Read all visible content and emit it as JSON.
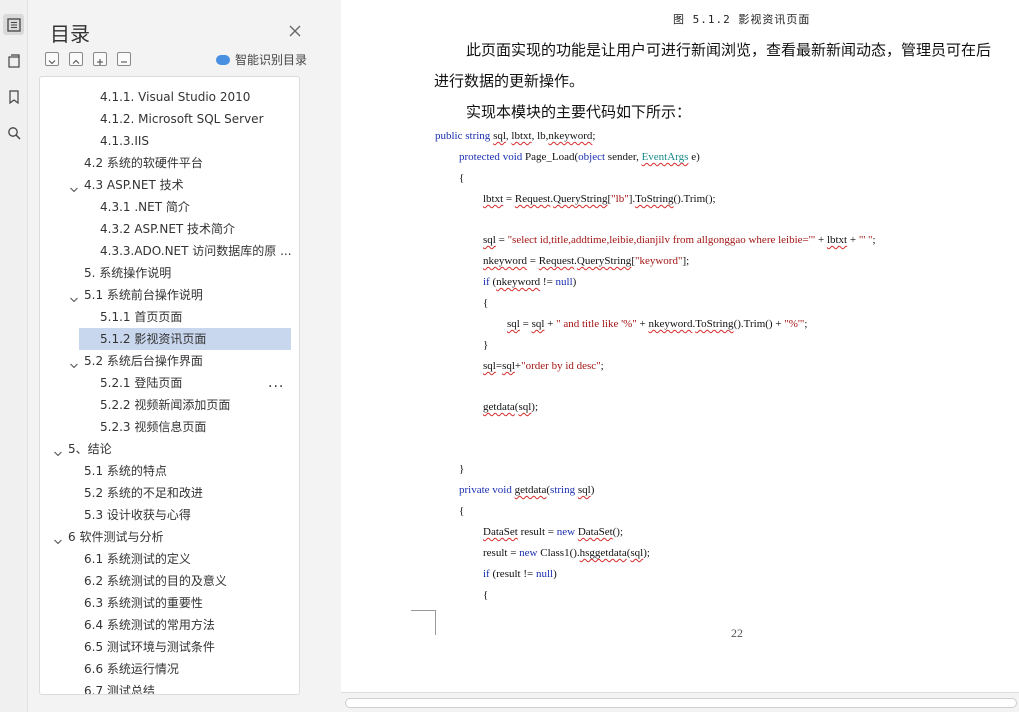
{
  "sidebar_rail": {
    "icons": [
      "toc-icon",
      "pages-icon",
      "bookmark-icon",
      "search-icon"
    ]
  },
  "toc": {
    "title": "目录",
    "smart_label": "智能识别目录",
    "items": [
      {
        "label": "4.1.1. Visual Studio 2010",
        "level": 3
      },
      {
        "label": "4.1.2. Microsoft SQL Server",
        "level": 3
      },
      {
        "label": "4.1.3.IIS",
        "level": 3
      },
      {
        "label": "4.2 系统的软硬件平台",
        "level": 2
      },
      {
        "label": "4.3 ASP.NET 技术",
        "level": 2,
        "expanded": true
      },
      {
        "label": "4.3.1 .NET 简介",
        "level": 3
      },
      {
        "label": "4.3.2 ASP.NET 技术简介",
        "level": 3
      },
      {
        "label": "4.3.3.ADO.NET 访问数据库的原 ...",
        "level": 3
      },
      {
        "label": "5. 系统操作说明",
        "level": 2
      },
      {
        "label": "5.1 系统前台操作说明",
        "level": 2,
        "expanded": true
      },
      {
        "label": "5.1.1 首页页面",
        "level": 3
      },
      {
        "label": "5.1.2 影视资讯页面",
        "level": 3,
        "selected": true
      },
      {
        "label": "5.2 系统后台操作界面",
        "level": 2,
        "expanded": true
      },
      {
        "label": "5.2.1 登陆页面",
        "level": 3,
        "more": "..."
      },
      {
        "label": "5.2.2 视频新闻添加页面",
        "level": 3
      },
      {
        "label": "5.2.3 视频信息页面",
        "level": 3
      },
      {
        "label": "5、结论",
        "level": 1,
        "expanded": true
      },
      {
        "label": "5.1 系统的特点",
        "level": 2
      },
      {
        "label": "5.2 系统的不足和改进",
        "level": 2
      },
      {
        "label": "5.3 设计收获与心得",
        "level": 2
      },
      {
        "label": "6 软件测试与分析",
        "level": 1,
        "expanded": true
      },
      {
        "label": "6.1 系统测试的定义",
        "level": 2
      },
      {
        "label": "6.2 系统测试的目的及意义",
        "level": 2
      },
      {
        "label": "6.3 系统测试的重要性",
        "level": 2
      },
      {
        "label": "6.4 系统测试的常用方法",
        "level": 2
      },
      {
        "label": "6.5 测试环境与测试条件",
        "level": 2
      },
      {
        "label": "6.6 系统运行情况",
        "level": 2
      },
      {
        "label": "6.7 测试总结",
        "level": 2
      }
    ]
  },
  "document": {
    "caption": "图 5.1.2 影视资讯页面",
    "para1_line1": "此页面实现的功能是让用户可进行新闻浏览，查看最新新闻动态，管理员可在后",
    "para1_line2": "进行数据的更新操作。",
    "para2": "实现本模块的主要代码如下所示：",
    "code_lines": [
      "public string sql, lbtxt, lb,nkeyword;",
      "protected void Page_Load(object sender, EventArgs e)",
      "{",
      "lbtxt = Request.QueryString[\"lb\"].ToString().Trim();",
      "sql = \"select id,title,addtime,leibie,dianjilv from allgonggao where leibie='\" + lbtxt + \"' \";",
      "nkeyword = Request.QueryString[\"keyword\"];",
      "if (nkeyword != null)",
      "{",
      "sql = sql + \" and title like '%\" + nkeyword.ToString().Trim() + \"%'\";",
      "}",
      "sql=sql+\"order by id desc\";",
      "getdata(sql);",
      "}",
      "private void getdata(string sql)",
      "{",
      "DataSet result = new DataSet();",
      "result = new Class1().hsggetdata(sql);",
      "if (result != null)",
      "{"
    ],
    "page_number": "22"
  }
}
